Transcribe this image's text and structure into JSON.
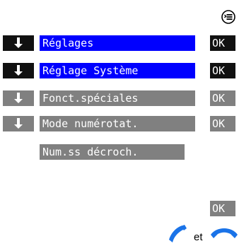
{
  "menu_icon": "menu-list-icon",
  "rows": [
    {
      "label": "Réglages",
      "ok": "OK",
      "arrow": "down-arrow-icon",
      "style": "active"
    },
    {
      "label": "Réglage Système",
      "ok": "OK",
      "arrow": "down-arrow-icon",
      "style": "active"
    },
    {
      "label": "Fonct.spéciales",
      "ok": "OK",
      "arrow": "down-arrow-icon",
      "style": "inactive"
    },
    {
      "label": "Mode numérotat.",
      "ok": "OK",
      "arrow": "down-arrow-icon",
      "style": "inactive"
    }
  ],
  "option": {
    "label": "Num.ss décroch."
  },
  "bottom_ok": "OK",
  "footer": {
    "conjunction": "et",
    "icons": [
      "handset-lift-icon",
      "handset-hangup-icon"
    ]
  },
  "colors": {
    "active_label": "#0000ff",
    "active_key": "#111111",
    "inactive": "#808080"
  }
}
